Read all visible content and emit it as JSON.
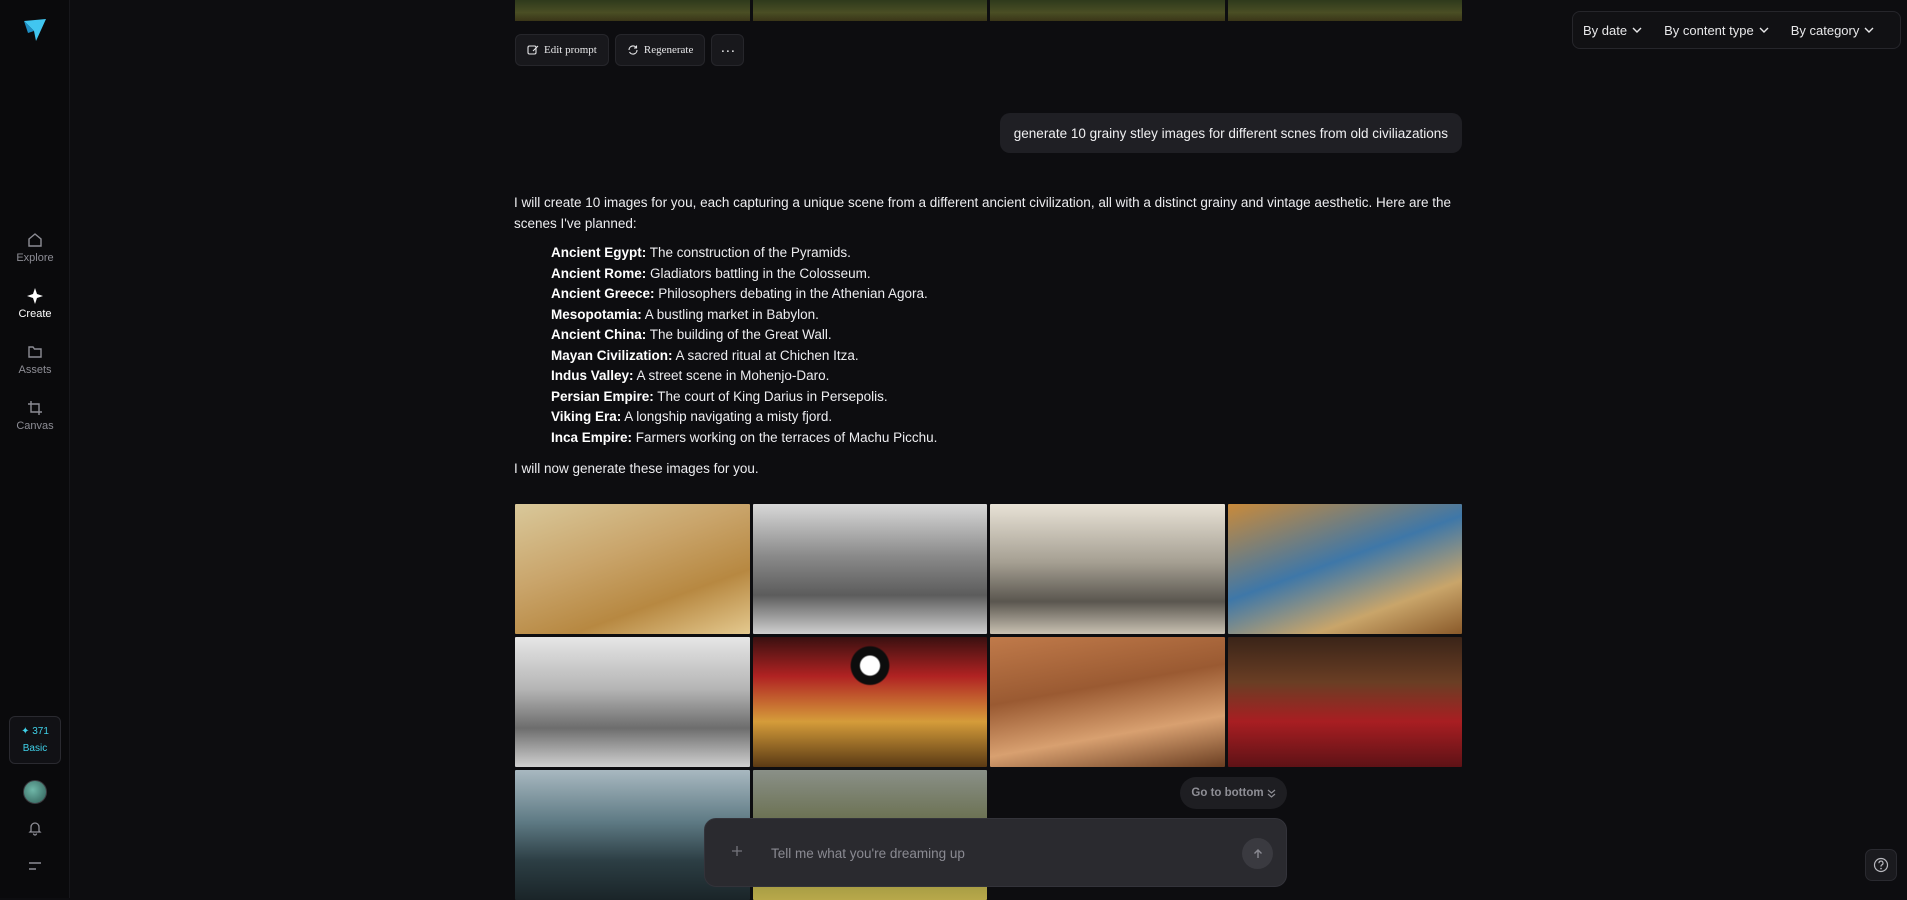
{
  "sidebar": {
    "items": [
      {
        "label": "Explore",
        "icon": "home-icon"
      },
      {
        "label": "Create",
        "icon": "sparkle-icon"
      },
      {
        "label": "Assets",
        "icon": "folder-icon"
      },
      {
        "label": "Canvas",
        "icon": "crop-icon"
      }
    ],
    "credits": {
      "amount": "✦ 371",
      "plan": "Basic"
    }
  },
  "filters": [
    "By date",
    "By content type",
    "By category"
  ],
  "actions": {
    "edit_prompt": "Edit prompt",
    "regenerate": "Regenerate",
    "more": "···"
  },
  "user_message": "generate 10 grainy stley images for different scnes from old civiliazations",
  "assistant": {
    "intro": "I will create 10 images for you, each capturing a unique scene from a different ancient civilization, all with a distinct grainy and vintage aesthetic. Here are the scenes I've planned:",
    "scenes": [
      {
        "name": "Ancient Egypt:",
        "desc": " The construction of the Pyramids."
      },
      {
        "name": "Ancient Rome:",
        "desc": " Gladiators battling in the Colosseum."
      },
      {
        "name": "Ancient Greece:",
        "desc": " Philosophers debating in the Athenian Agora."
      },
      {
        "name": "Mesopotamia:",
        "desc": " A bustling market in Babylon."
      },
      {
        "name": "Ancient China:",
        "desc": " The building of the Great Wall."
      },
      {
        "name": "Mayan Civilization:",
        "desc": " A sacred ritual at Chichen Itza."
      },
      {
        "name": "Indus Valley:",
        "desc": " A street scene in Mohenjo-Daro."
      },
      {
        "name": "Persian Empire:",
        "desc": " The court of King Darius in Persepolis."
      },
      {
        "name": "Viking Era:",
        "desc": " A longship navigating a misty fjord."
      },
      {
        "name": "Inca Empire:",
        "desc": " Farmers working on the terraces of Machu Picchu."
      }
    ],
    "outro": "I will now generate these images for you."
  },
  "go_bottom": "Go to bottom",
  "composer": {
    "placeholder": "Tell me what you're dreaming up"
  },
  "colors": {
    "accent": "#3fd0e8",
    "background": "#0d0d10",
    "bubble": "#1f1f24"
  }
}
